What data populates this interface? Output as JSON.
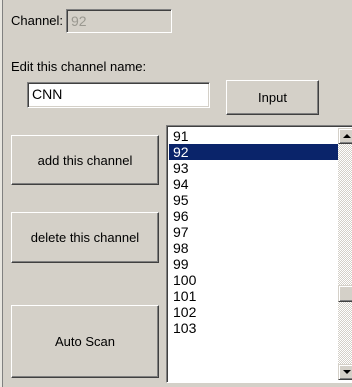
{
  "channel": {
    "label": "Channel:",
    "value": "92"
  },
  "edit": {
    "label": "Edit this channel name:",
    "name_value": "CNN",
    "input_button": "Input"
  },
  "buttons": {
    "add": "add this channel",
    "delete": "delete this channel",
    "auto_scan": "Auto Scan"
  },
  "channel_list": {
    "items": [
      "91",
      "92",
      "93",
      "94",
      "95",
      "96",
      "97",
      "98",
      "99",
      "100",
      "101",
      "102",
      "103"
    ],
    "selected_index": 1
  },
  "colors": {
    "selection": "#0a246a",
    "face": "#d4d0c8"
  }
}
